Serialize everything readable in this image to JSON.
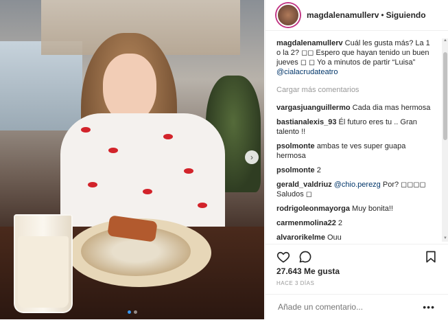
{
  "header": {
    "username": "magdalenamullerv",
    "separator": "•",
    "follow_status": "Siguiendo"
  },
  "caption": {
    "username": "magdalenamullerv",
    "text": " Cuál les gusta más? La 1 o la 2? ◻◻ Espero que hayan tenido un buen jueves ◻ ◻ Yo a minutos de partir “Luisa” ",
    "mention": "@cialacrudateatro"
  },
  "load_more": "Cargar más comentarios",
  "comments": [
    {
      "user": "vargasjuanguillermo",
      "text": "Cada dia mas hermosa"
    },
    {
      "user": "bastianalexis_93",
      "text": "Él futuro eres tu .. Gran talento !!"
    },
    {
      "user": "psolmonte",
      "text": "ambas te ves super guapa hermosa"
    },
    {
      "user": "psolmonte",
      "text": "2"
    },
    {
      "user": "gerald_valdriuz",
      "mention": "@chio.perezg",
      "text": " Por? ◻◻◻◻ Saludos ◻"
    },
    {
      "user": "rodrigoleonmayorga",
      "text": "Muy bonita!!"
    },
    {
      "user": "carmenmolina22",
      "text": "2"
    },
    {
      "user": "alvarorikelme",
      "text": "Ouu"
    }
  ],
  "likes": "27.643 Me gusta",
  "date": "HACE 3 DÍAS",
  "comment_input": {
    "placeholder": "Añade un comentario..."
  },
  "more_options": "•••",
  "carousel": {
    "slides": 2,
    "active": 1
  },
  "colors": {
    "accent": "#3897f0",
    "text": "#262626",
    "muted": "#999999",
    "link": "#003569"
  }
}
